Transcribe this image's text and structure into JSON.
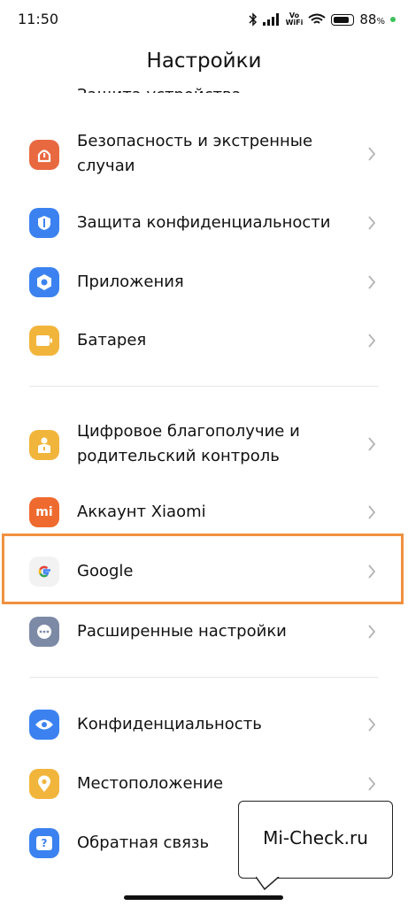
{
  "status_bar": {
    "time": "11:50",
    "bluetooth": "bluetooth-icon",
    "signal": "signal-icon",
    "vowifi_top": "Vo",
    "vowifi_bottom": "WiFi",
    "wifi": "wifi-icon",
    "battery_percent": "88",
    "percent_sign": "%"
  },
  "header": {
    "title": "Настройки",
    "partial_item": "Защита устройства"
  },
  "items": [
    {
      "label": "Безопасность и экстренные случаи",
      "icon": "emergency-icon",
      "color": "#e8683f"
    },
    {
      "label": "Защита конфиденциальности",
      "icon": "privacy-shield-icon",
      "color": "#3b82f0"
    },
    {
      "label": "Приложения",
      "icon": "apps-icon",
      "color": "#3b82f0"
    },
    {
      "label": "Батарея",
      "icon": "battery-icon",
      "color": "#f2b53b"
    },
    {
      "label_line1": "Цифровое благополучие и",
      "label_line2": "родительский контроль",
      "icon": "wellbeing-icon",
      "color": "#f2b53b"
    },
    {
      "label": "Аккаунт Xiaomi",
      "icon": "mi-icon",
      "icon_text": "mi",
      "color": "#ee6a2e"
    },
    {
      "label": "Google",
      "icon": "google-icon",
      "icon_text": "G",
      "color": "#f2f2f2"
    },
    {
      "label": "Расширенные настройки",
      "icon": "more-icon",
      "color": "#7d8aa6"
    },
    {
      "label": "Конфиденциальность",
      "icon": "eye-icon",
      "color": "#3b82f0"
    },
    {
      "label": "Местоположение",
      "icon": "location-icon",
      "color": "#f2b53b"
    },
    {
      "label": "Обратная связь",
      "icon": "feedback-icon",
      "icon_text": "?",
      "color": "#3b82f0"
    }
  ],
  "safety_line1": "Безопасность и экстренные",
  "safety_line2": "случаи",
  "watermark": "Mi-Check.ru"
}
